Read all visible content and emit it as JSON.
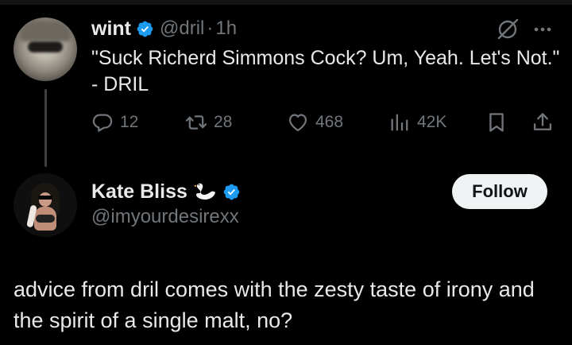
{
  "parent_tweet": {
    "author_name": "wint",
    "handle": "@dril",
    "separator": "·",
    "time": "1h",
    "text": "\"Suck Richerd Simmons Cock? Um, Yeah. Let's Not.\" - DRIL",
    "stats": {
      "replies": "12",
      "reposts": "28",
      "likes": "468",
      "views": "42K"
    },
    "icons": [
      "verified-badge-icon",
      "grok-icon",
      "more-icon",
      "reply-icon",
      "repost-icon",
      "like-icon",
      "views-icon",
      "bookmark-icon",
      "share-icon"
    ]
  },
  "reply_tweet": {
    "author_name": "Kate Bliss",
    "handle": "@imyourdesirexx",
    "follow_label": "Follow",
    "text": "advice from dril comes with the zesty taste of irony and the spirit of a single malt, no?",
    "icons": [
      "swan-icon",
      "verified-badge-icon"
    ]
  },
  "colors": {
    "background": "#000000",
    "primary_text": "#e7e9ea",
    "secondary_text": "#71767b",
    "verified_blue": "#1d9bf0",
    "follow_button_bg": "#eff3f4",
    "follow_button_text": "#0f1419"
  }
}
